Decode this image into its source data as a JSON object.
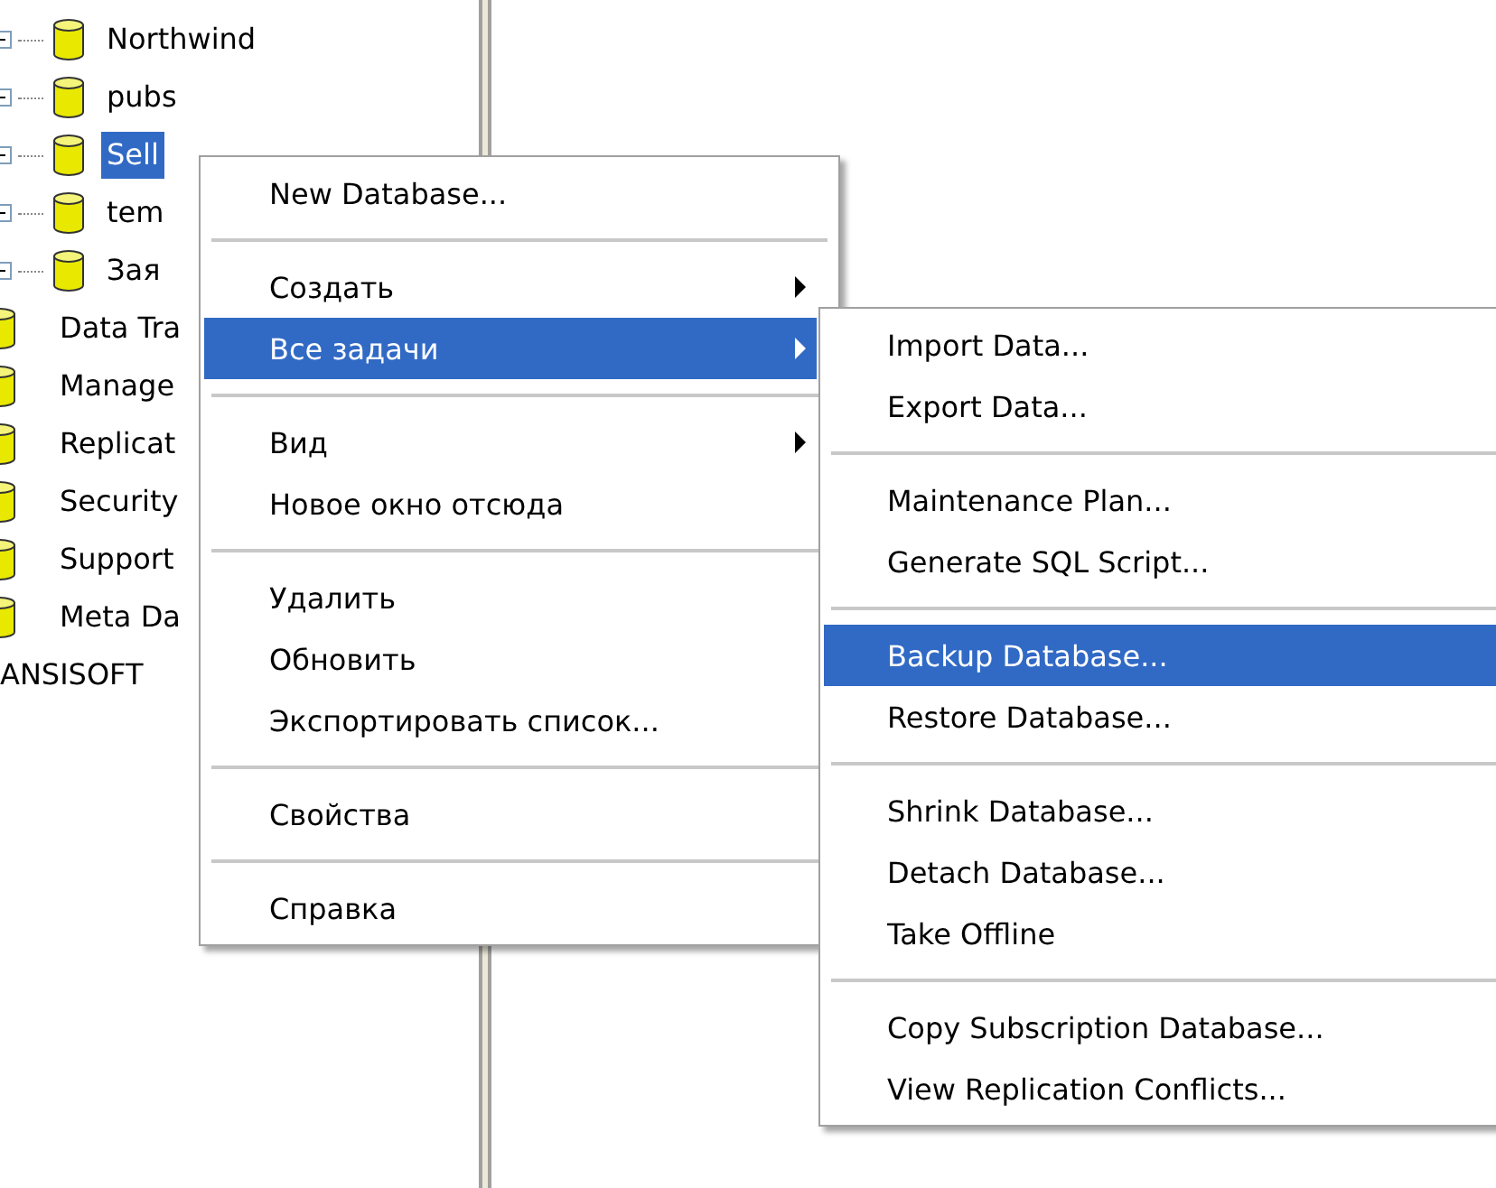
{
  "tree": {
    "databases": [
      {
        "label": "Northwind",
        "selected": false
      },
      {
        "label": "pubs",
        "selected": false
      },
      {
        "label": "Sell",
        "selected": true
      },
      {
        "label": "tem",
        "selected": false
      },
      {
        "label": "Зая",
        "selected": false
      }
    ],
    "server_nodes": [
      {
        "label": "Data Tra",
        "selected": false
      },
      {
        "label": "Manage",
        "selected": false
      },
      {
        "label": "Replicat",
        "selected": false
      },
      {
        "label": "Security",
        "selected": false
      },
      {
        "label": "Support",
        "selected": false
      },
      {
        "label": "Meta Da",
        "selected": false
      }
    ],
    "server": "ANSISOFT"
  },
  "context_menu": {
    "items": [
      {
        "kind": "item",
        "label": "New Database...",
        "selected": false,
        "has_submenu": false
      },
      {
        "kind": "separator"
      },
      {
        "kind": "item",
        "label": "Создать",
        "selected": false,
        "has_submenu": true
      },
      {
        "kind": "item",
        "label": "Все задачи",
        "selected": true,
        "has_submenu": true
      },
      {
        "kind": "separator"
      },
      {
        "kind": "item",
        "label": "Вид",
        "selected": false,
        "has_submenu": true
      },
      {
        "kind": "item",
        "label": "Новое окно отсюда",
        "selected": false,
        "has_submenu": false
      },
      {
        "kind": "separator"
      },
      {
        "kind": "item",
        "label": "Удалить",
        "selected": false,
        "has_submenu": false
      },
      {
        "kind": "item",
        "label": "Обновить",
        "selected": false,
        "has_submenu": false
      },
      {
        "kind": "item",
        "label": "Экспортировать список...",
        "selected": false,
        "has_submenu": false
      },
      {
        "kind": "separator"
      },
      {
        "kind": "item",
        "label": "Свойства",
        "selected": false,
        "has_submenu": false
      },
      {
        "kind": "separator"
      },
      {
        "kind": "item",
        "label": "Справка",
        "selected": false,
        "has_submenu": false
      }
    ]
  },
  "submenu": {
    "items": [
      {
        "kind": "item",
        "label": "Import Data...",
        "selected": false
      },
      {
        "kind": "item",
        "label": "Export Data...",
        "selected": false
      },
      {
        "kind": "separator"
      },
      {
        "kind": "item",
        "label": "Maintenance Plan...",
        "selected": false
      },
      {
        "kind": "item",
        "label": "Generate SQL Script...",
        "selected": false
      },
      {
        "kind": "separator"
      },
      {
        "kind": "item",
        "label": "Backup Database...",
        "selected": true
      },
      {
        "kind": "item",
        "label": "Restore Database...",
        "selected": false
      },
      {
        "kind": "separator"
      },
      {
        "kind": "item",
        "label": "Shrink Database...",
        "selected": false
      },
      {
        "kind": "item",
        "label": "Detach Database...",
        "selected": false
      },
      {
        "kind": "item",
        "label": "Take Offline",
        "selected": false
      },
      {
        "kind": "separator"
      },
      {
        "kind": "item",
        "label": "Copy Subscription Database...",
        "selected": false
      },
      {
        "kind": "item",
        "label": "View Replication Conflicts...",
        "selected": false
      }
    ]
  }
}
